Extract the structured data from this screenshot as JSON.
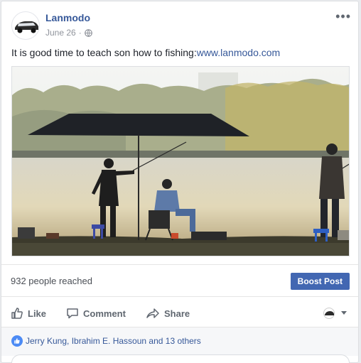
{
  "post": {
    "page_name": "Lanmodo",
    "date": "June 26",
    "separator": "·",
    "audience_icon": "globe-icon",
    "more_icon": "ellipsis-icon",
    "text": "It is good time to teach son how to fishing:",
    "link_text": "www.lanmodo.com"
  },
  "stats": {
    "reach_text": "932 people reached",
    "boost_label": "Boost Post"
  },
  "actions": {
    "like_label": "Like",
    "comment_label": "Comment",
    "share_label": "Share",
    "like_icon": "thumbs-up-icon",
    "comment_icon": "speech-bubble-icon",
    "share_icon": "share-arrow-icon",
    "audience_selector_icon": "page-avatar-dropdown-icon"
  },
  "reactions": {
    "icon": "like-badge-icon",
    "text": "Jerry Kung, Ibrahim E. Hassoun and 13 others"
  },
  "colors": {
    "link_blue": "#365899",
    "boost_blue": "#4267b2",
    "like_badge": "#4c8bf5",
    "page_bg": "#e9ebee"
  }
}
